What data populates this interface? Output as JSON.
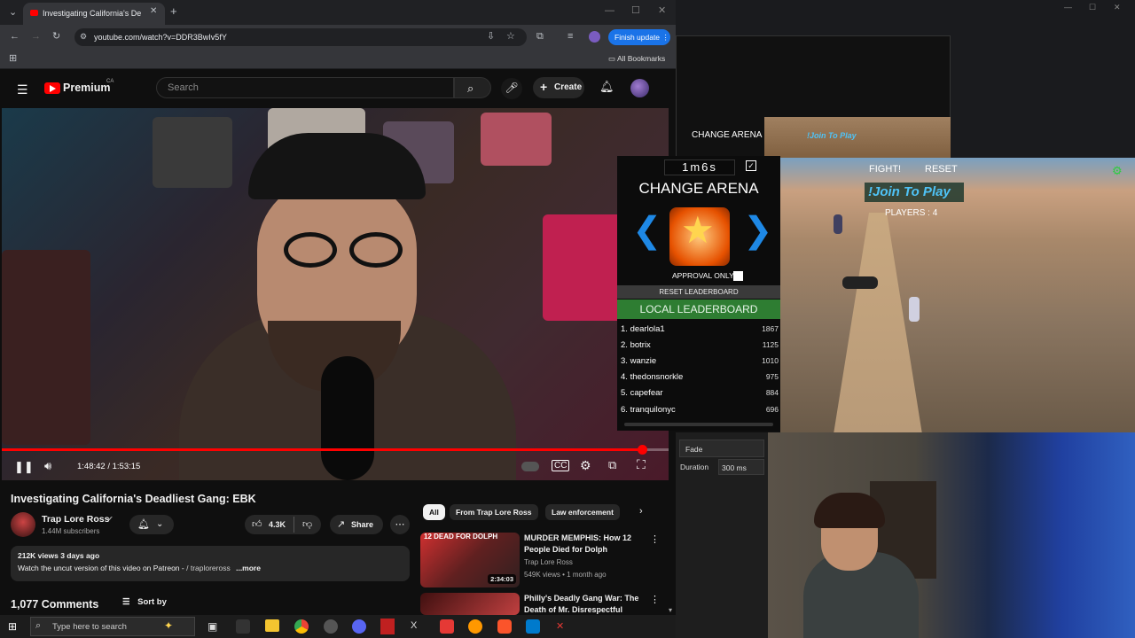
{
  "browser": {
    "tab_title": "Investigating California's De",
    "url": "youtube.com/watch?v=DDR3BwIv5fY",
    "finish_update": "Finish update",
    "all_bookmarks": "All Bookmarks"
  },
  "youtube": {
    "logo": "Premium",
    "region": "CA",
    "search_placeholder": "Search",
    "create": "Create"
  },
  "player": {
    "time": "1:48:42 / 1:53:15",
    "progress": 0.96
  },
  "video": {
    "title": "Investigating California's Deadliest Gang: EBK",
    "channel": "Trap Lore Ross",
    "subscribers": "1.44M subscribers",
    "likes": "4.3K",
    "share": "Share",
    "views_date": "212K views  3 days ago",
    "description": "Watch the uncut version of this video on Patreon -",
    "patreon_link": " / traploreross",
    "more": "...more",
    "comments": "1,077 Comments",
    "sort": "Sort by"
  },
  "chips": [
    "All",
    "From Trap Lore Ross",
    "Law enforcement"
  ],
  "recommendations": [
    {
      "title": "MURDER MEMPHIS: How 12 People Died for Dolph",
      "channel": "Trap Lore Ross",
      "meta": "549K views • 1 month ago",
      "duration": "2:34:03",
      "thumb_text": "12 DEAD FOR DOLPH"
    },
    {
      "title": "Philly's Deadly Gang War: The Death of Mr. Disrespectful",
      "channel": "",
      "meta": "",
      "duration": "",
      "thumb_text": ""
    }
  ],
  "game": {
    "timer": "1m6s",
    "change_arena": "CHANGE ARENA",
    "approval_only": "APPROVAL ONLY",
    "reset_leaderboard": "RESET LEADERBOARD",
    "local_leaderboard": "LOCAL LEADERBOARD",
    "fight": "FIGHT!",
    "reset": "RESET",
    "join": "!Join To Play",
    "players": "PLAYERS : 4",
    "leaderboard": [
      {
        "rank": "1.",
        "name": "dearlola1",
        "score": "1867"
      },
      {
        "rank": "2.",
        "name": "botrix",
        "score": "1125"
      },
      {
        "rank": "3.",
        "name": "wanzie",
        "score": "1010"
      },
      {
        "rank": "4.",
        "name": "thedonsnorkle",
        "score": "975"
      },
      {
        "rank": "5.",
        "name": "capefear",
        "score": "884"
      },
      {
        "rank": "6.",
        "name": "tranquilonyc",
        "score": "696"
      }
    ]
  },
  "obs": {
    "fade": "Fade",
    "duration_label": "Duration",
    "duration_value": "300 ms"
  },
  "taskbar": {
    "search": "Type here to search"
  }
}
